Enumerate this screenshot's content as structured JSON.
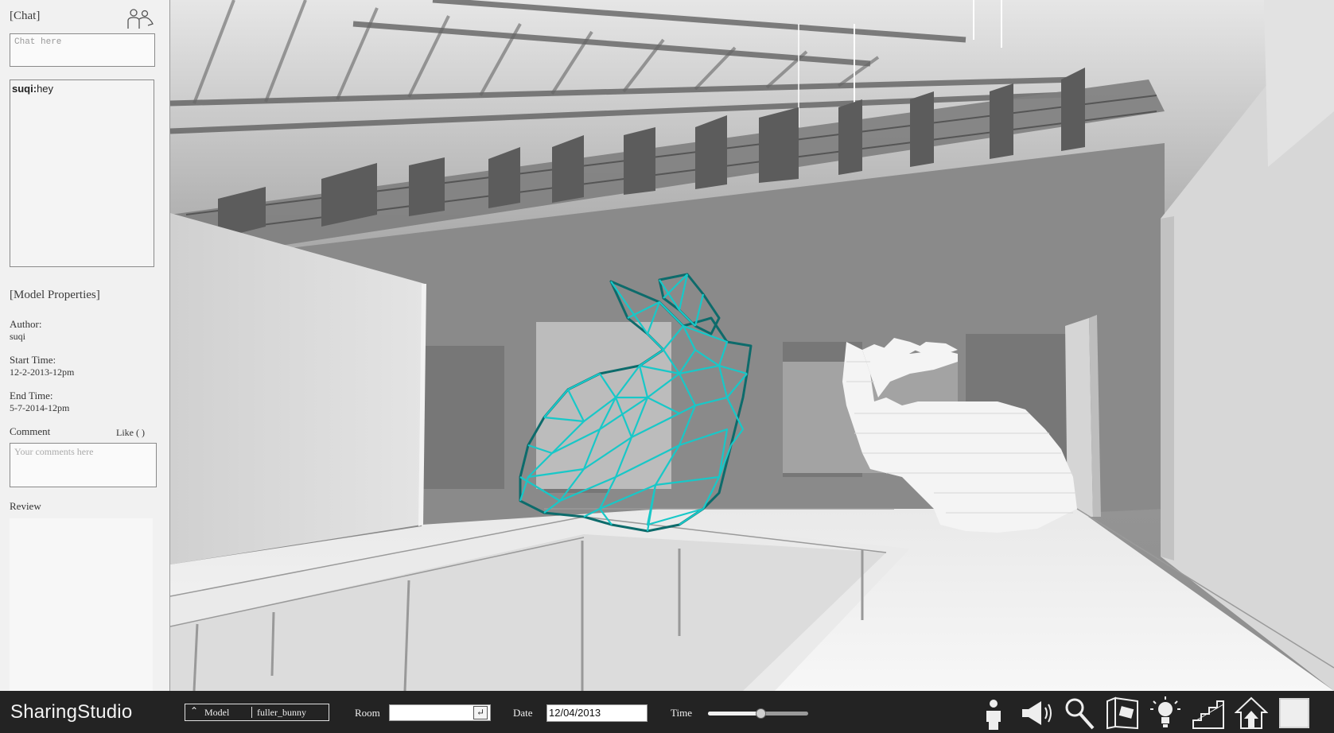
{
  "chat": {
    "title": "[Chat]",
    "input_placeholder": "Chat here",
    "messages": [
      {
        "user": "suqi:",
        "text": "hey"
      }
    ]
  },
  "model_properties": {
    "title": "[Model Properties]",
    "author_label": "Author:",
    "author": "suqi",
    "start_label": "Start Time:",
    "start": "12-2-2013-12pm",
    "end_label": "End Time:",
    "end": "5-7-2014-12pm",
    "comment_label": "Comment",
    "like_label": "Like ( )",
    "comment_placeholder": "Your comments here",
    "review_label": "Review"
  },
  "bottom_bar": {
    "brand": "SharingStudio",
    "model_toggle": "Model",
    "model_name": "fuller_bunny",
    "room_label": "Room",
    "room_value": "",
    "date_label": "Date",
    "date_value": "12/04/2013",
    "time_label": "Time",
    "time_slider_fraction": 0.52
  },
  "toolbar_icons": [
    "person-icon",
    "megaphone-icon",
    "search-icon",
    "map-view-icon",
    "lightbulb-icon",
    "stairs-icon",
    "home-icon",
    "fullscreen-icon"
  ],
  "colors": {
    "wireframe_model": "#18c8c8",
    "bottom_bar": "#232323",
    "panel": "#f1f1f1"
  }
}
